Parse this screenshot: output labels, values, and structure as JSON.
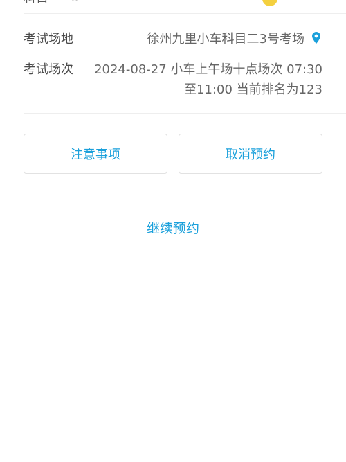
{
  "top_row": {
    "partial_label": "科目"
  },
  "exam_location": {
    "label": "考试场地",
    "value": "徐州九里小车科目二3号考场",
    "icon": "location-pin-icon"
  },
  "exam_session": {
    "label": "考试场次",
    "value_line1": "2024-08-27 小车上午场十点场次 07:30",
    "value_line2": "至11:00 当前排名为123"
  },
  "buttons": {
    "notice_label": "注意事项",
    "cancel_label": "取消预约"
  },
  "links": {
    "continue_label": "继续预约"
  },
  "colors": {
    "accent": "#1aa0db",
    "status_yellow": "#f4d03f"
  }
}
